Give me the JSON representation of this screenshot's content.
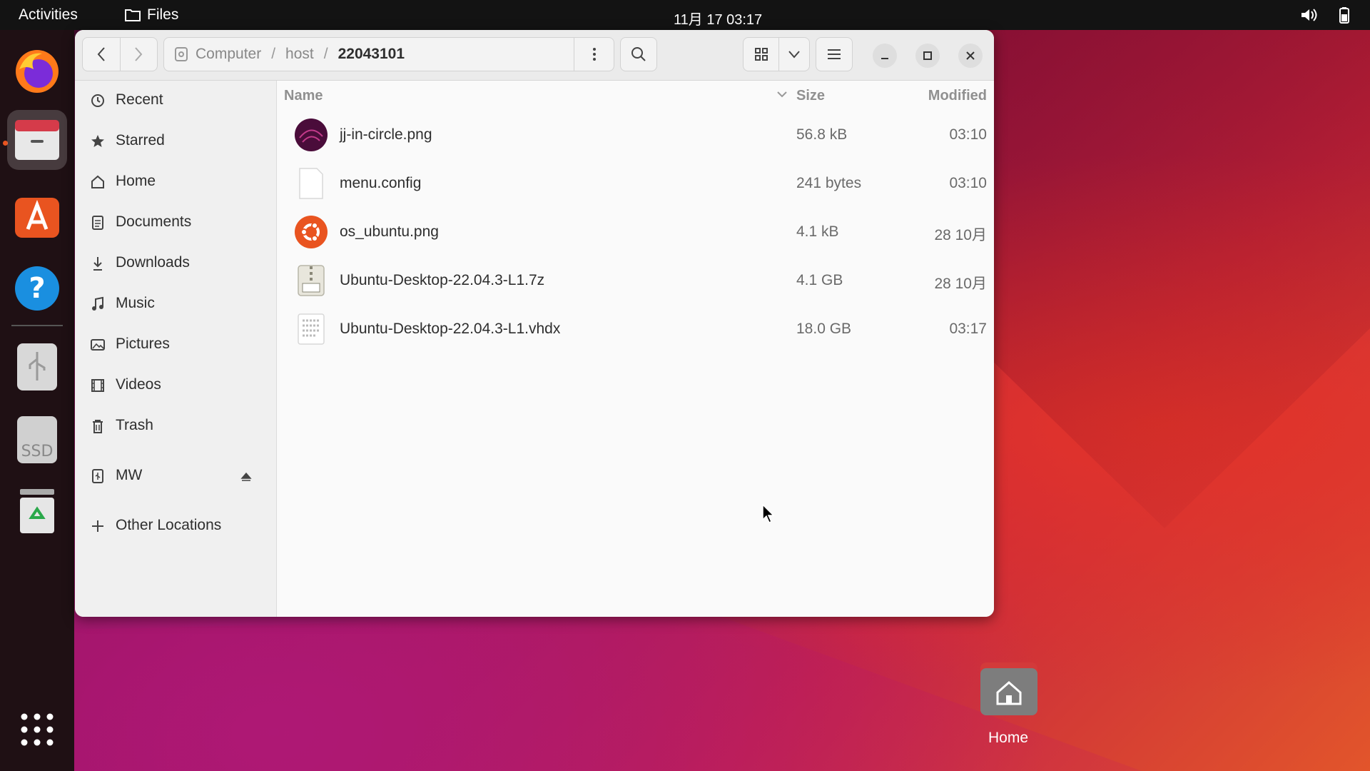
{
  "topbar": {
    "activities": "Activities",
    "app_name": "Files",
    "clock": "11月 17  03:17"
  },
  "dock": {
    "items": [
      {
        "name": "Firefox",
        "icon": "firefox-icon"
      },
      {
        "name": "Files",
        "icon": "files-icon",
        "active": true
      },
      {
        "name": "Ubuntu Software",
        "icon": "app-store-icon"
      },
      {
        "name": "Help",
        "icon": "help-icon"
      },
      {
        "name": "USB drive",
        "icon": "usb-drive-icon"
      },
      {
        "name": "SSD",
        "icon": "ssd-drive-icon",
        "label": "SSD"
      },
      {
        "name": "Trash",
        "icon": "trash-icon"
      },
      {
        "name": "Show Applications",
        "icon": "app-grid-icon"
      }
    ]
  },
  "window": {
    "path": {
      "segments": [
        "Computer",
        "host",
        "22043101"
      ]
    },
    "sidebar": {
      "items": [
        {
          "label": "Recent",
          "icon": "clock-icon"
        },
        {
          "label": "Starred",
          "icon": "star-icon"
        },
        {
          "label": "Home",
          "icon": "home-icon"
        },
        {
          "label": "Documents",
          "icon": "document-icon"
        },
        {
          "label": "Downloads",
          "icon": "download-icon"
        },
        {
          "label": "Music",
          "icon": "music-icon"
        },
        {
          "label": "Pictures",
          "icon": "picture-icon"
        },
        {
          "label": "Videos",
          "icon": "video-icon"
        },
        {
          "label": "Trash",
          "icon": "trash-icon"
        }
      ],
      "device": {
        "label": "MW",
        "icon": "usb-icon"
      },
      "other": {
        "label": "Other Locations",
        "icon": "plus-icon"
      }
    },
    "columns": {
      "name": "Name",
      "size": "Size",
      "modified": "Modified"
    },
    "files": [
      {
        "name": "jj-in-circle.png",
        "size": "56.8 kB",
        "modified": "03:10",
        "icon": "image-file-icon"
      },
      {
        "name": "menu.config",
        "size": "241 bytes",
        "modified": "03:10",
        "icon": "text-file-icon"
      },
      {
        "name": "os_ubuntu.png",
        "size": "4.1 kB",
        "modified": "28 10月",
        "icon": "ubuntu-logo-file-icon"
      },
      {
        "name": "Ubuntu-Desktop-22.04.3-L1.7z",
        "size": "4.1 GB",
        "modified": "28 10月",
        "icon": "archive-file-icon"
      },
      {
        "name": "Ubuntu-Desktop-22.04.3-L1.vhdx",
        "size": "18.0 GB",
        "modified": "03:17",
        "icon": "binary-file-icon"
      }
    ]
  },
  "desktop": {
    "home_label": "Home"
  },
  "colors": {
    "ubuntu_orange": "#e95420",
    "topbar": "#131313",
    "window_bg": "#fafafa"
  }
}
